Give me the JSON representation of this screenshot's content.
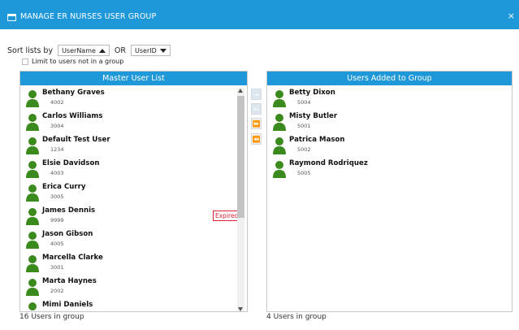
{
  "window": {
    "title": "MANAGE ER NURSES USER GROUP",
    "close_glyph": "×"
  },
  "sort": {
    "label": "Sort lists by",
    "primary": "UserName",
    "or_text": "OR",
    "secondary": "UserID"
  },
  "limit": {
    "label": "Limit to users not in a group",
    "checked": false
  },
  "master": {
    "header": "Master User List",
    "users": [
      {
        "name": "Bethany Graves",
        "id": "4002",
        "badge": ""
      },
      {
        "name": "Carlos Williams",
        "id": "3004",
        "badge": ""
      },
      {
        "name": "Default Test User",
        "id": "1234",
        "badge": ""
      },
      {
        "name": "Elsie Davidson",
        "id": "4003",
        "badge": ""
      },
      {
        "name": "Erica Curry",
        "id": "3005",
        "badge": ""
      },
      {
        "name": "James Dennis",
        "id": "9999",
        "badge": "Expired"
      },
      {
        "name": "Jason Gibson",
        "id": "4005",
        "badge": ""
      },
      {
        "name": "Marcella Clarke",
        "id": "3001",
        "badge": ""
      },
      {
        "name": "Marta Haynes",
        "id": "2002",
        "badge": ""
      },
      {
        "name": "Mimi Daniels",
        "id": "",
        "badge": ""
      }
    ],
    "count_text": "16 Users in group"
  },
  "group": {
    "header": "Users Added to Group",
    "users": [
      {
        "name": "Betty Dixon",
        "id": "5004"
      },
      {
        "name": "Misty Butler",
        "id": "5001"
      },
      {
        "name": "Patrica Mason",
        "id": "5002"
      },
      {
        "name": "Raymond Rodriquez",
        "id": "5005"
      }
    ],
    "count_text": "4 Users in group"
  },
  "transfer": {
    "add_one": "→",
    "remove_one": "←",
    "add_all": "⏩",
    "remove_all": "⏪"
  },
  "colors": {
    "accent": "#1e98d8",
    "avatar": "#3b8a1e",
    "badge": "#d22233"
  },
  "icons": {
    "avatar": "user-silhouette-icon",
    "title": "window-icon"
  }
}
